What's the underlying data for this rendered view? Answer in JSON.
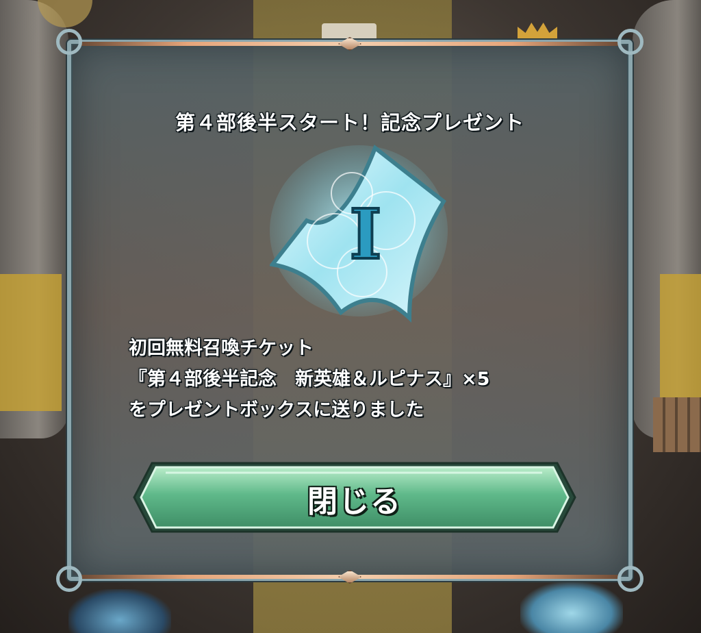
{
  "dialog": {
    "title": "第４部後半スタート！記念プレゼント",
    "item_icon": "summon-ticket-icon",
    "ticket_mark": "I",
    "message_lines": [
      "初回無料召喚チケット",
      "『第４部後半記念　新英雄＆ルピナス』×5",
      "をプレゼントボックスに送りました"
    ],
    "close_label": "閉じる"
  },
  "colors": {
    "button_green": "#5fb98a",
    "frame_copper": "#e6a57a",
    "frame_steel": "#8ba6ad",
    "ticket_cyan": "#9fe3f0"
  }
}
